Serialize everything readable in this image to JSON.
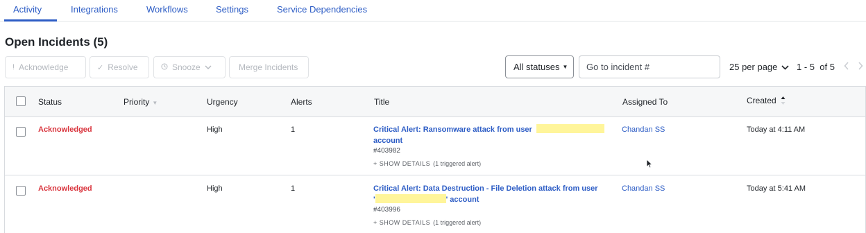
{
  "tabs": [
    {
      "label": "Activity"
    },
    {
      "label": "Integrations"
    },
    {
      "label": "Workflows"
    },
    {
      "label": "Settings"
    },
    {
      "label": "Service Dependencies"
    }
  ],
  "page_title": "Open Incidents (5)",
  "toolbar": {
    "acknowledge_label": "Acknowledge",
    "resolve_label": "Resolve",
    "snooze_label": "Snooze",
    "merge_label": "Merge Incidents",
    "status_filter": "All statuses",
    "incident_search_placeholder": "Go to incident #",
    "per_page": "25 per page",
    "pager_info": "1 - 5  of 5"
  },
  "table": {
    "headers": {
      "status": "Status",
      "priority": "Priority",
      "urgency": "Urgency",
      "alerts": "Alerts",
      "title": "Title",
      "assigned_to": "Assigned To",
      "created": "Created"
    },
    "rows": [
      {
        "status": "Acknowledged",
        "urgency": "High",
        "alerts": "1",
        "title_line1": "Critical Alert: Ransomware attack from user",
        "title_line2": "account",
        "incident_number": "#403982",
        "show_details": "+ SHOW DETAILS",
        "triggered": "(1 triggered alert)",
        "assigned_to": "Chandan SS",
        "created": "Today at 4:11 AM"
      },
      {
        "status": "Acknowledged",
        "urgency": "High",
        "alerts": "1",
        "title_line1": "Critical Alert: Data Destruction - File Deletion attack from user",
        "title_line2_prefix": "'",
        "title_line2_suffix": "' account",
        "incident_number": "#403996",
        "show_details": "+ SHOW DETAILS",
        "triggered": "(1 triggered alert)",
        "assigned_to": "Chandan SS",
        "created": "Today at 5:41 AM"
      }
    ]
  },
  "colors": {
    "accent": "#2c5cc5",
    "acknowledged": "#d9343d",
    "redaction": "#fff59a"
  }
}
